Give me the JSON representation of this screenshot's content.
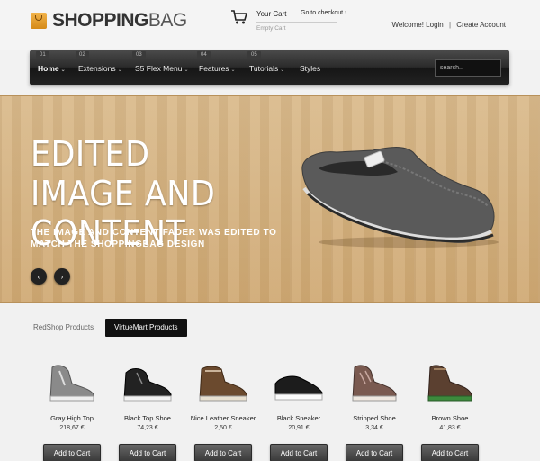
{
  "header": {
    "logo_bold": "SHOPPING",
    "logo_light": "BAG",
    "cart_title": "Your Cart",
    "cart_checkout": "Go to checkout",
    "cart_checkout_arrow": "›",
    "cart_status": "Empty Cart",
    "welcome": "Welcome!",
    "login": "Login",
    "separator": "|",
    "create_account": "Create Account"
  },
  "nav": {
    "items": [
      {
        "num": "01",
        "label": "Home",
        "arrow": "⌄"
      },
      {
        "num": "02",
        "label": "Extensions",
        "arrow": "⌄"
      },
      {
        "num": "03",
        "label": "S5 Flex Menu",
        "arrow": "⌄"
      },
      {
        "num": "04",
        "label": "Features",
        "arrow": "⌄"
      },
      {
        "num": "05",
        "label": "Tutorials",
        "arrow": "⌄"
      },
      {
        "num": "",
        "label": "Styles",
        "arrow": ""
      }
    ],
    "search_placeholder": "search.."
  },
  "hero": {
    "title": "EDITED IMAGE AND CONTENT",
    "subtitle": "THE IMAGE AND CONTENT FADER WAS EDITED TO MATCH THE SHOPPINGBAG DESIGN",
    "prev_icon": "‹",
    "next_icon": "›"
  },
  "tabs": {
    "redshop": "RedShop Products",
    "virtuemart": "VirtueMart Products"
  },
  "products": [
    {
      "name": "Gray High Top",
      "price": "218,67 €",
      "button": "Add to Cart"
    },
    {
      "name": "Black Top Shoe",
      "price": "74,23 €",
      "button": "Add to Cart"
    },
    {
      "name": "Nice Leather Sneaker",
      "price": "2,50 €",
      "button": "Add to Cart"
    },
    {
      "name": "Black Sneaker",
      "price": "20,91 €",
      "button": "Add to Cart"
    },
    {
      "name": "Stripped Shoe",
      "price": "3,34 €",
      "button": "Add to Cart"
    },
    {
      "name": "Brown Shoe",
      "price": "41,83 €",
      "button": "Add to Cart"
    }
  ],
  "colors": {
    "nav_bg": "#222222",
    "hero_wood": "#d4b07d",
    "button_bg": "#4a4a4a",
    "logo_bag": "#e6a233"
  }
}
